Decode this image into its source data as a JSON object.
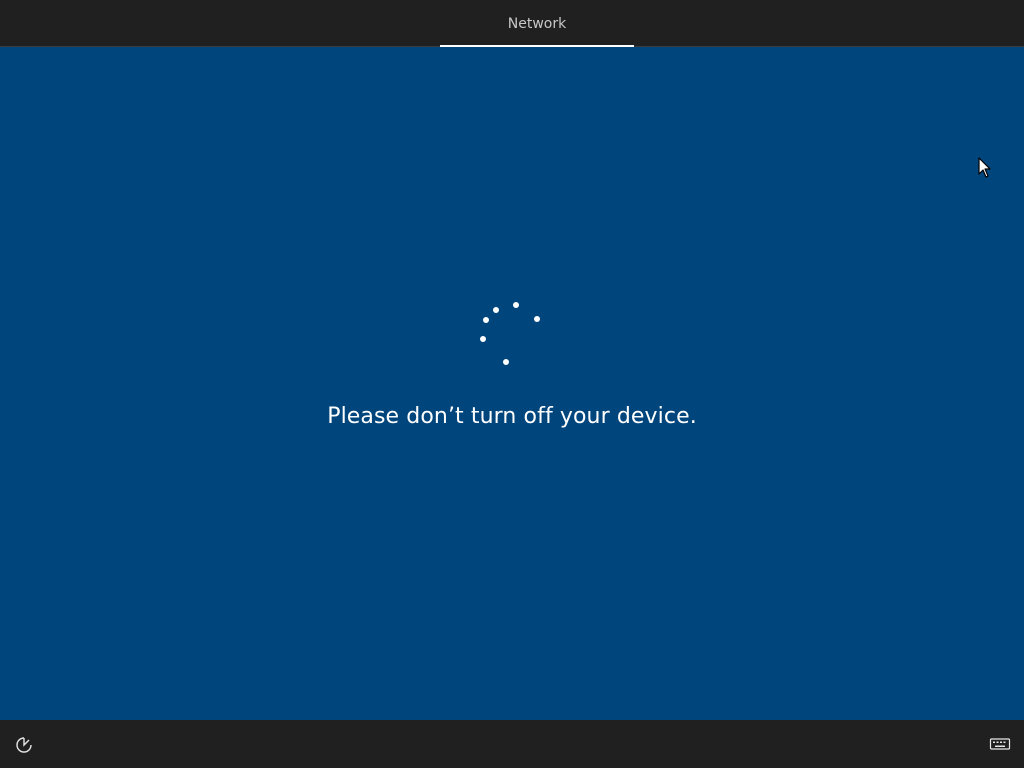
{
  "header": {
    "active_tab_label": "Network"
  },
  "main": {
    "message": "Please don’t turn off your device."
  },
  "footer": {
    "left_icon": "ease-of-access-icon",
    "right_icon": "keyboard-icon"
  },
  "colors": {
    "background": "#00457c",
    "bar": "#202020",
    "text": "#ffffff",
    "tab_text": "#c8c8c8"
  }
}
